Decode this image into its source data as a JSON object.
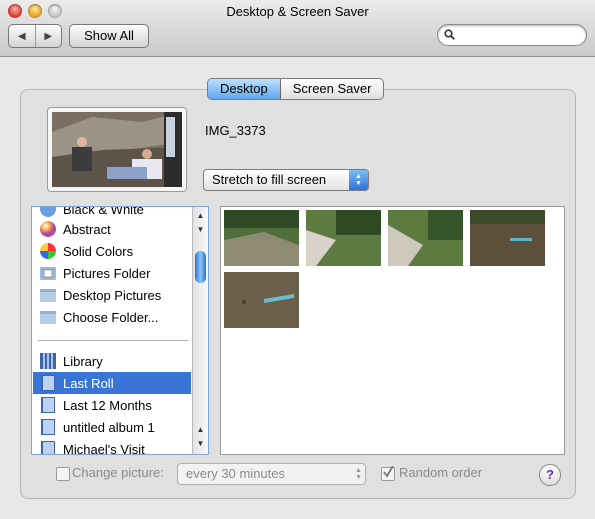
{
  "window": {
    "title": "Desktop & Screen Saver"
  },
  "toolbar": {
    "back_icon": "back-arrow-icon",
    "forward_icon": "forward-arrow-icon",
    "show_all_label": "Show All",
    "search_placeholder": ""
  },
  "tabs": [
    {
      "label": "Desktop",
      "selected": true
    },
    {
      "label": "Screen Saver",
      "selected": false
    }
  ],
  "preview": {
    "image_name": "IMG_3373",
    "scaling": "Stretch to fill screen"
  },
  "sources": [
    {
      "label": "Black & White",
      "icon": "colorful-sphere-icon"
    },
    {
      "label": "Abstract",
      "icon": "colorful-sphere-icon"
    },
    {
      "label": "Solid Colors",
      "icon": "color-wheel-icon"
    },
    {
      "label": "Pictures Folder",
      "icon": "pictures-folder-icon"
    },
    {
      "label": "Desktop Pictures",
      "icon": "folder-icon"
    },
    {
      "label": "Choose Folder...",
      "icon": "folder-icon"
    },
    {
      "label": "Library",
      "icon": "iphoto-library-icon"
    },
    {
      "label": "Last Roll",
      "icon": "iphoto-album-icon",
      "selected": true
    },
    {
      "label": "Last 12 Months",
      "icon": "iphoto-album-icon"
    },
    {
      "label": "untitled album 1",
      "icon": "iphoto-album-icon"
    },
    {
      "label": "Michael's Visit",
      "icon": "iphoto-album-icon"
    }
  ],
  "photos_count_visible": 5,
  "bottom": {
    "change_picture_label": "Change picture:",
    "change_picture_checked": false,
    "interval": "every 30 minutes",
    "random_label": "Random order",
    "random_checked": true,
    "help_label": "?"
  },
  "colors": {
    "selection": "#3875d7",
    "tab_selected": "#5ea7ec"
  }
}
